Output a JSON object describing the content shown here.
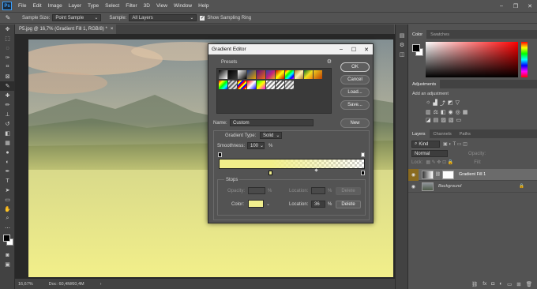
{
  "app": {
    "logo": "Ps"
  },
  "menu": [
    "File",
    "Edit",
    "Image",
    "Layer",
    "Type",
    "Select",
    "Filter",
    "3D",
    "View",
    "Window",
    "Help"
  ],
  "window_controls": [
    "–",
    "❐",
    "✕"
  ],
  "options_bar": {
    "sample_size_label": "Sample Size:",
    "sample_size_value": "Point Sample",
    "sample_label": "Sample:",
    "sample_value": "All Layers",
    "show_ring_label": "Show Sampling Ring"
  },
  "document": {
    "tab_title": "P5.jpg @ 16,7% (Gradient Fill 1, RGB/8) *",
    "zoom": "16,67%",
    "doc_size": "Doc: 60,4M/60,4M"
  },
  "color_panel": {
    "tabs": [
      "Color",
      "Swatches"
    ],
    "fg_color": "#000000",
    "bg_color": "#ffffff"
  },
  "adjustments_panel": {
    "tab": "Adjustments",
    "heading": "Add an adjustment"
  },
  "layers_panel": {
    "tabs": [
      "Layers",
      "Channels",
      "Paths"
    ],
    "kind_placeholder": "Kind",
    "blend_mode": "Normal",
    "opacity_label": "Opacity:",
    "lock_label": "Lock:",
    "fill_label": "Fill:",
    "layers": [
      {
        "name": "Gradient Fill 1",
        "selected": true
      },
      {
        "name": "Background",
        "selected": false
      }
    ]
  },
  "gradient_editor": {
    "title": "Gradient Editor",
    "presets_label": "Presets",
    "buttons": {
      "ok": "OK",
      "cancel": "Cancel",
      "load": "Load...",
      "save": "Save...",
      "new": "New"
    },
    "name_label": "Name:",
    "name_value": "Custom",
    "gradient_type_label": "Gradient Type:",
    "gradient_type_value": "Solid",
    "smoothness_label": "Smoothness:",
    "smoothness_value": "100",
    "smoothness_unit": "%",
    "stops_label": "Stops",
    "opacity_label": "Opacity:",
    "opacity_unit": "%",
    "location_label": "Location:",
    "location_unit": "%",
    "delete_label": "Delete",
    "color_label": "Color:",
    "color_location_value": "36",
    "stop_color": "#f0ee8e",
    "gradient_start_color": "#f2ef8a"
  }
}
